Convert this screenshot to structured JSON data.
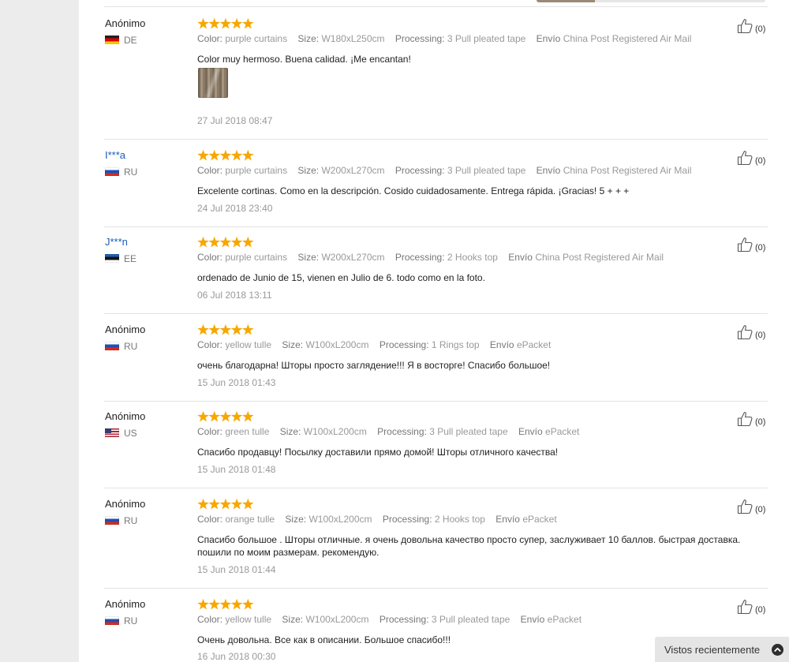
{
  "reviews": [
    {
      "user": "Anónimo",
      "country": "DE",
      "flag": "de",
      "color_label": "Color:",
      "color": "purple curtains",
      "size_label": "Size:",
      "size": "W180xL250cm",
      "processing_label": "Processing:",
      "processing": "3 Pull pleated tape",
      "shipping_label": "Envío",
      "shipping": "China Post Registered Air Mail",
      "text": "Color muy hermoso. Buena calidad. ¡Me encantan!",
      "date": "27 Jul 2018 08:47",
      "rating": 5,
      "likes": "(0)",
      "has_photo": true
    },
    {
      "user": "I***a",
      "country": "RU",
      "flag": "ru",
      "color_label": "Color:",
      "color": "purple curtains",
      "size_label": "Size:",
      "size": "W200xL270cm",
      "processing_label": "Processing:",
      "processing": "3 Pull pleated tape",
      "shipping_label": "Envío",
      "shipping": "China Post Registered Air Mail",
      "text": "Excelente cortinas. Como en la descripción. Cosido cuidadosamente. Entrega rápida. ¡Gracias! 5 + + +",
      "date": "24 Jul 2018 23:40",
      "rating": 5,
      "likes": "(0)"
    },
    {
      "user": "J***n",
      "country": "EE",
      "flag": "ee",
      "color_label": "Color:",
      "color": "purple curtains",
      "size_label": "Size:",
      "size": "W200xL270cm",
      "processing_label": "Processing:",
      "processing": "2 Hooks top",
      "shipping_label": "Envío",
      "shipping": "China Post Registered Air Mail",
      "text": "ordenado de Junio de 15, vienen en Julio de 6. todo como en la foto.",
      "date": "06 Jul 2018 13:11",
      "rating": 5,
      "likes": "(0)"
    },
    {
      "user": "Anónimo",
      "country": "RU",
      "flag": "ru",
      "color_label": "Color:",
      "color": "yellow tulle",
      "size_label": "Size:",
      "size": "W100xL200cm",
      "processing_label": "Processing:",
      "processing": "1 Rings top",
      "shipping_label": "Envío",
      "shipping": "ePacket",
      "text": "очень благодарна! Шторы просто заглядение!!! Я в восторге! Спасибо большое!",
      "date": "15 Jun 2018 01:43",
      "rating": 5,
      "likes": "(0)"
    },
    {
      "user": "Anónimo",
      "country": "US",
      "flag": "us",
      "color_label": "Color:",
      "color": "green tulle",
      "size_label": "Size:",
      "size": "W100xL200cm",
      "processing_label": "Processing:",
      "processing": "3 Pull pleated tape",
      "shipping_label": "Envío",
      "shipping": "ePacket",
      "text": "Спасибо продавцу! Посылку доставили прямо домой! Шторы отличного качества!",
      "date": "15 Jun 2018 01:48",
      "rating": 5,
      "likes": "(0)"
    },
    {
      "user": "Anónimo",
      "country": "RU",
      "flag": "ru",
      "color_label": "Color:",
      "color": "orange tulle",
      "size_label": "Size:",
      "size": "W100xL200cm",
      "processing_label": "Processing:",
      "processing": "2 Hooks top",
      "shipping_label": "Envío",
      "shipping": "ePacket",
      "text": "Спасибо большое . Шторы отличные. я очень довольна качество просто супер, заслуживает 10 баллов. быстрая доставка. пошили по моим размерам. рекомендую.",
      "date": "15 Jun 2018 01:44",
      "rating": 5,
      "likes": "(0)"
    },
    {
      "user": "Anónimo",
      "country": "RU",
      "flag": "ru",
      "color_label": "Color:",
      "color": "yellow tulle",
      "size_label": "Size:",
      "size": "W100xL200cm",
      "processing_label": "Processing:",
      "processing": "3 Pull pleated tape",
      "shipping_label": "Envío",
      "shipping": "ePacket",
      "text": "Очень довольна. Все как в описании. Большое спасибо!!!",
      "date": "16 Jun 2018 00:30",
      "rating": 5,
      "likes": "(0)"
    }
  ],
  "recently_viewed": {
    "label": "Vistos recientemente"
  },
  "colors": {
    "star": "#f7a700",
    "user_link": "#1a5cb8",
    "muted_text": "#999999"
  }
}
